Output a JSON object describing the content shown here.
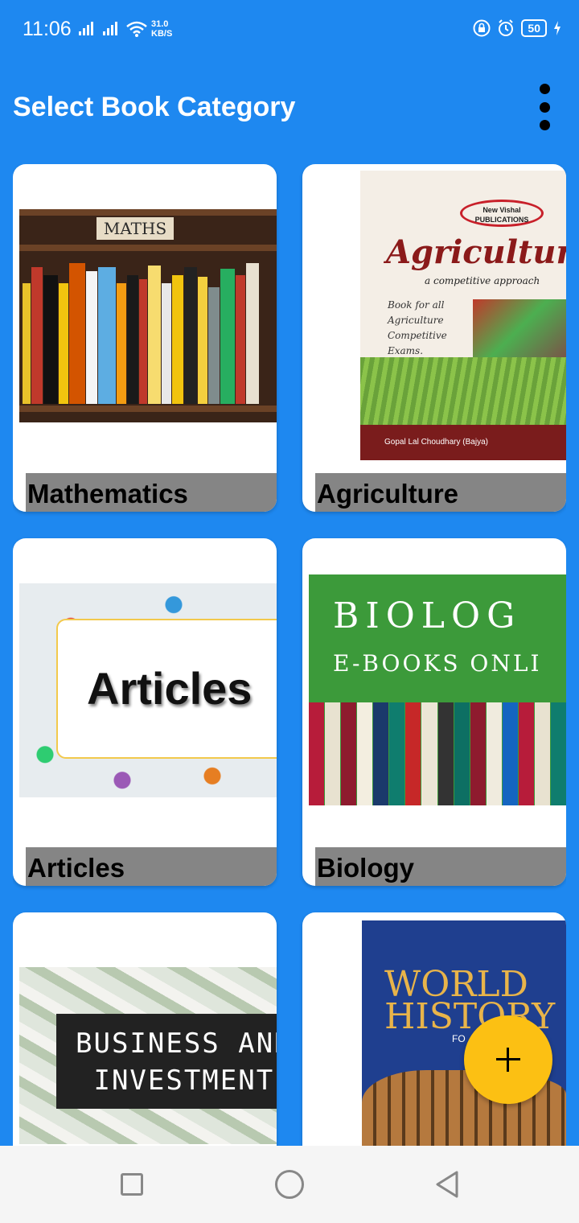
{
  "status_bar": {
    "time": "11:06",
    "net_speed_value": "31.0",
    "net_speed_unit": "KB/S",
    "battery": "50",
    "icons": [
      "signal-icon",
      "signal-icon",
      "wifi-icon",
      "lock-icon",
      "alarm-icon",
      "battery-icon",
      "charging-icon"
    ]
  },
  "app_bar": {
    "title": "Select Book Category",
    "menu_icon": "overflow-menu-icon"
  },
  "categories": [
    {
      "label": "Mathematics",
      "image_text": "MATHS"
    },
    {
      "label": "Agriculture",
      "image_title": "Agriculture",
      "image_subtitle": "a competitive approach",
      "image_publisher": "New Vishal PUBLICATIONS",
      "image_blurb": "Book for all Agriculture Competitive Exams.",
      "image_author": "Gopal Lal Choudhary (Bajya)"
    },
    {
      "label": "Articles",
      "image_text": "Articles"
    },
    {
      "label": "Biology",
      "image_title": "BIOLOG",
      "image_subtitle": "E-BOOKS ONLI"
    },
    {
      "label": "",
      "image_line1": "BUSINESS AND",
      "image_line2": "INVESTMENT"
    },
    {
      "label": "",
      "image_line1": "WORLD",
      "image_line2": "HISTORY",
      "image_extra": "FO"
    }
  ],
  "fab": {
    "icon": "plus-icon"
  },
  "nav_bar": {
    "icons": [
      "recent-apps-icon",
      "home-icon",
      "back-icon"
    ]
  },
  "colors": {
    "primary": "#1E88F0",
    "accent": "#FCC013",
    "caption_bg": "#858585"
  }
}
